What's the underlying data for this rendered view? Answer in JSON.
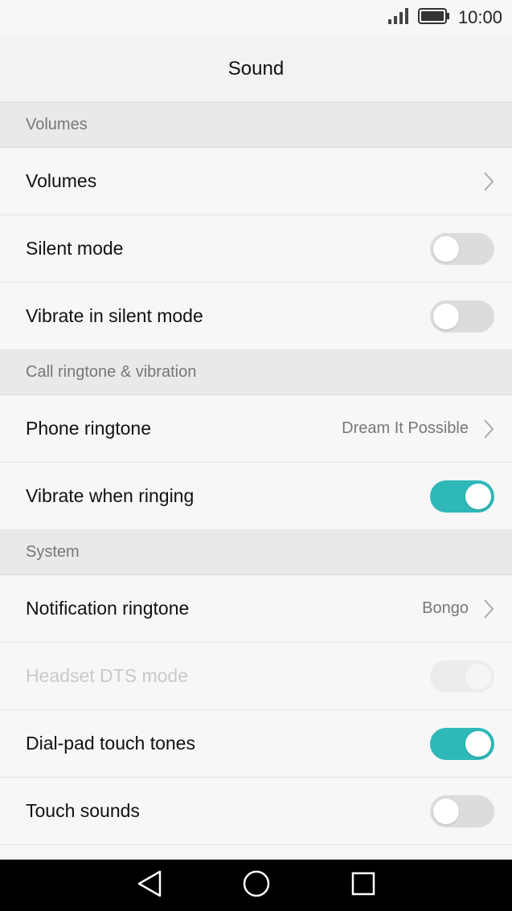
{
  "status": {
    "time": "10:00"
  },
  "header": {
    "title": "Sound"
  },
  "sections": {
    "volumes": {
      "title": "Volumes",
      "items": {
        "volumes": {
          "label": "Volumes"
        },
        "silent_mode": {
          "label": "Silent mode",
          "enabled": false
        },
        "vibrate_silent": {
          "label": "Vibrate in silent mode",
          "enabled": false
        }
      }
    },
    "call": {
      "title": "Call ringtone & vibration",
      "items": {
        "phone_ringtone": {
          "label": "Phone ringtone",
          "value": "Dream It Possible"
        },
        "vibrate_ringing": {
          "label": "Vibrate when ringing",
          "enabled": true
        }
      }
    },
    "system": {
      "title": "System",
      "items": {
        "notification_ringtone": {
          "label": "Notification ringtone",
          "value": "Bongo"
        },
        "headset_dts": {
          "label": "Headset DTS mode",
          "enabled": true,
          "disabled": true
        },
        "dialpad_tones": {
          "label": "Dial-pad touch tones",
          "enabled": true
        },
        "touch_sounds": {
          "label": "Touch sounds",
          "enabled": false
        }
      }
    }
  },
  "colors": {
    "accent": "#2fb8b8",
    "background": "#f7f7f7",
    "section": "#e9e9e9"
  },
  "nav": {
    "back_icon": "back-triangle-icon",
    "home_icon": "home-circle-icon",
    "recents_icon": "recents-square-icon"
  }
}
